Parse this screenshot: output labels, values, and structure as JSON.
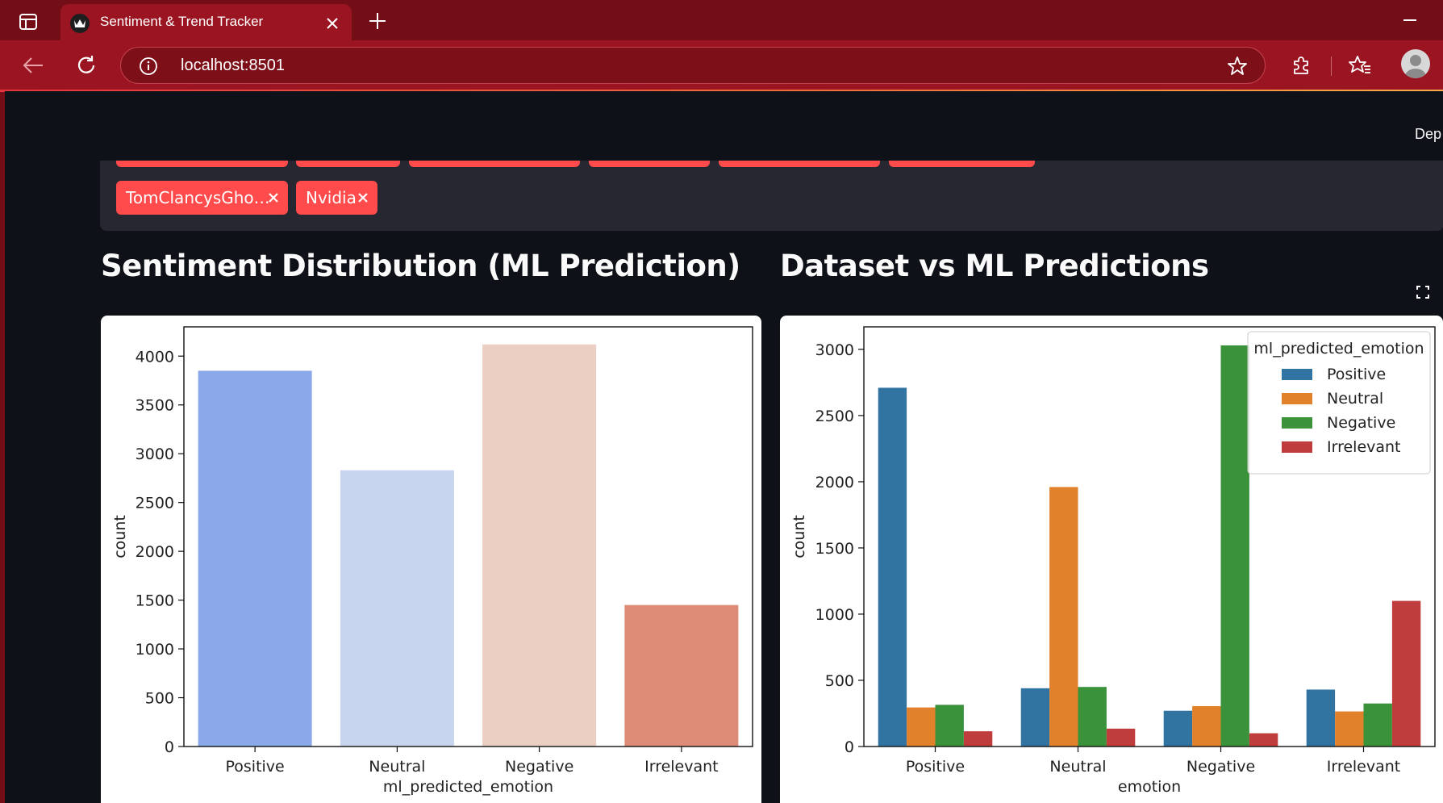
{
  "browser": {
    "tab_title": "Sentiment & Trend Tracker",
    "url": "localhost:8501",
    "icons": {
      "tab_actions": "tab-actions-icon",
      "favicon": "crown-icon",
      "close": "close-icon",
      "new_tab": "plus-icon",
      "minimize": "minimize-icon",
      "back": "back-arrow-icon",
      "reload": "reload-icon",
      "site_info": "info-icon",
      "favorite": "star-icon",
      "extensions": "puzzle-icon",
      "favorites_list": "favorites-icon",
      "profile": "avatar-icon"
    },
    "colors": {
      "frame": "#730e17",
      "toolbar": "#9a1521",
      "accent": "#ff4b4b"
    }
  },
  "app": {
    "deploy_label": "Dep",
    "multiselect": {
      "chips": [
        "TomClancysGho…",
        "Nvidia"
      ]
    },
    "left_heading": "Sentiment Distribution (ML Prediction)",
    "right_heading": "Dataset vs ML Predictions"
  },
  "chart_data": [
    {
      "type": "bar",
      "xlabel": "ml_predicted_emotion",
      "ylabel": "count",
      "categories": [
        "Positive",
        "Neutral",
        "Negative",
        "Irrelevant"
      ],
      "values": [
        3850,
        2830,
        4120,
        1450
      ],
      "colors": [
        "#8aa8ea",
        "#c8d5ef",
        "#eacfc2",
        "#dd8d77"
      ],
      "ylim": [
        0,
        4300
      ],
      "yticks": [
        0,
        500,
        1000,
        1500,
        2000,
        2500,
        3000,
        3500,
        4000
      ],
      "grid": false,
      "legend": false
    },
    {
      "type": "bar",
      "xlabel": "emotion",
      "ylabel": "count",
      "categories": [
        "Positive",
        "Neutral",
        "Negative",
        "Irrelevant"
      ],
      "series": [
        {
          "name": "Positive",
          "color": "#3274a1",
          "values": [
            2710,
            440,
            270,
            430
          ]
        },
        {
          "name": "Neutral",
          "color": "#e1812c",
          "values": [
            295,
            1960,
            305,
            265
          ]
        },
        {
          "name": "Negative",
          "color": "#3a923a",
          "values": [
            315,
            450,
            3030,
            325
          ]
        },
        {
          "name": "Irrelevant",
          "color": "#c03d3e",
          "values": [
            115,
            135,
            100,
            1100
          ]
        }
      ],
      "legend_title": "ml_predicted_emotion",
      "legend_position": "top-right",
      "ylim": [
        0,
        3170
      ],
      "yticks": [
        0,
        500,
        1000,
        1500,
        2000,
        2500,
        3000
      ],
      "grid": false
    }
  ]
}
